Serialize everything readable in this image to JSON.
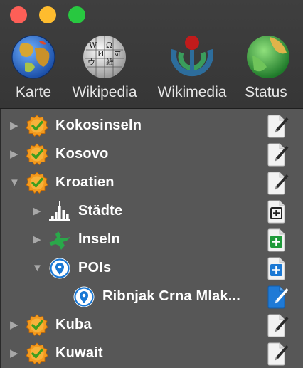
{
  "window": {
    "controls": [
      "close",
      "minimize",
      "zoom"
    ]
  },
  "toolbar": {
    "items": [
      {
        "label": "Karte",
        "icon": "globe-map-icon"
      },
      {
        "label": "Wikipedia",
        "icon": "wikipedia-globe-icon"
      },
      {
        "label": "Wikimedia",
        "icon": "wikimedia-logo-icon"
      },
      {
        "label": "Status",
        "icon": "status-globe-icon"
      }
    ]
  },
  "tree": {
    "rows": [
      {
        "label": "Kokosinseln",
        "expanded": false,
        "icon": "verified-badge-icon",
        "action": "edit-document-icon"
      },
      {
        "label": "Kosovo",
        "expanded": false,
        "icon": "verified-badge-icon",
        "action": "edit-document-icon"
      },
      {
        "label": "Kroatien",
        "expanded": true,
        "icon": "verified-badge-icon",
        "action": "edit-document-icon"
      },
      {
        "label": "Städte",
        "expanded": false,
        "icon": "city-skyline-icon",
        "action": "add-document-icon"
      },
      {
        "label": "Inseln",
        "expanded": false,
        "icon": "island-icon",
        "action": "add-document-green-icon"
      },
      {
        "label": "POIs",
        "expanded": true,
        "icon": "location-pin-icon",
        "action": "add-document-blue-icon"
      },
      {
        "label": "Ribnjak Crna Mlak...",
        "expanded": null,
        "icon": "location-pin-icon",
        "action": "edit-document-blue-icon"
      },
      {
        "label": "Kuba",
        "expanded": false,
        "icon": "verified-badge-icon",
        "action": "edit-document-icon"
      },
      {
        "label": "Kuwait",
        "expanded": false,
        "icon": "verified-badge-icon",
        "action": "edit-document-icon"
      }
    ]
  },
  "colors": {
    "close": "#fe5f57",
    "minimize": "#febc2e",
    "zoom": "#28c840",
    "badge": "#f39a1e",
    "check": "#4caf2a",
    "pin": "#1a78d4",
    "island": "#2aa84a"
  }
}
